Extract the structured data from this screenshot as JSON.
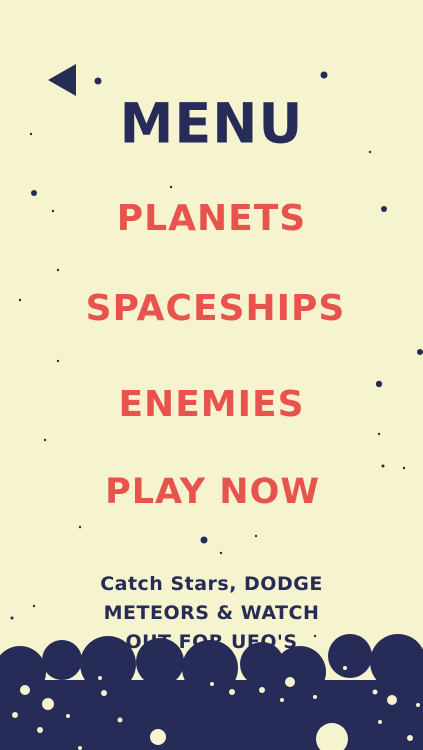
{
  "menu": {
    "title": "MENU",
    "items": [
      {
        "label": "PLANETS"
      },
      {
        "label": "SPACESHIPS"
      },
      {
        "label": "ENEMIES"
      },
      {
        "label": "PLAY NOW"
      }
    ]
  },
  "tagline": {
    "line1": "Catch Stars, DODGE",
    "line2": "METEORS & WATCH",
    "line3": "OUT FOR UFO'S"
  },
  "icons": {
    "back": "back-arrow-icon"
  },
  "colors": {
    "background": "#f6f3cf",
    "navy": "#262b57",
    "red": "#e8534d",
    "white": "#ffffff"
  }
}
